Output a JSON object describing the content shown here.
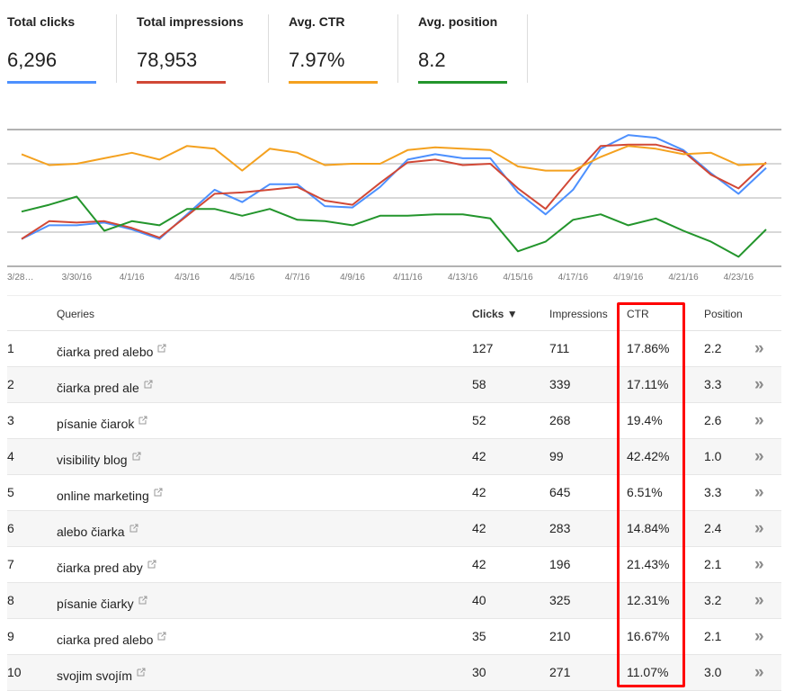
{
  "metrics": [
    {
      "label": "Total clicks",
      "value": "6,296",
      "color": "#4d90fe"
    },
    {
      "label": "Total impressions",
      "value": "78,953",
      "color": "#d14836"
    },
    {
      "label": "Avg. CTR",
      "value": "7.97%",
      "color": "#f4a11f"
    },
    {
      "label": "Avg. position",
      "value": "8.2",
      "color": "#23952c"
    }
  ],
  "chart_data": {
    "type": "line",
    "title": "",
    "xlabel": "",
    "ylabel": "",
    "grid": true,
    "legend": "none (metric tiles act as legend)",
    "x": [
      "3/28/16",
      "3/29/16",
      "3/30/16",
      "3/31/16",
      "4/1/16",
      "4/2/16",
      "4/3/16",
      "4/4/16",
      "4/5/16",
      "4/6/16",
      "4/7/16",
      "4/8/16",
      "4/9/16",
      "4/10/16",
      "4/11/16",
      "4/12/16",
      "4/13/16",
      "4/14/16",
      "4/15/16",
      "4/16/16",
      "4/17/16",
      "4/18/16",
      "4/19/16",
      "4/20/16",
      "4/21/16",
      "4/22/16",
      "4/23/16",
      "4/24/16"
    ],
    "tick_labels": [
      "3/28…",
      "3/30/16",
      "4/1/16",
      "4/3/16",
      "4/5/16",
      "4/7/16",
      "4/9/16",
      "4/11/16",
      "4/13/16",
      "4/15/16",
      "4/17/16",
      "4/19/16",
      "4/21/16",
      "4/23/16"
    ],
    "y_scale_note": "each series on its own hidden axis; values are relative (0-100)",
    "ylim": [
      0,
      100
    ],
    "series": [
      {
        "name": "Total clicks",
        "color": "#4d90fe",
        "values": [
          20,
          30,
          30,
          32,
          27,
          20,
          38,
          56,
          47,
          60,
          60,
          44,
          43,
          58,
          78,
          82,
          79,
          79,
          54,
          38,
          56,
          86,
          96,
          94,
          85,
          68,
          53,
          72
        ]
      },
      {
        "name": "Total impressions",
        "color": "#d14836",
        "values": [
          20,
          33,
          32,
          33,
          28,
          21,
          37,
          53,
          54,
          56,
          58,
          48,
          45,
          61,
          76,
          78,
          74,
          75,
          57,
          42,
          66,
          88,
          89,
          89,
          84,
          67,
          57,
          76
        ]
      },
      {
        "name": "Avg. CTR",
        "color": "#f4a11f",
        "values": [
          82,
          74,
          75,
          79,
          83,
          78,
          88,
          86,
          70,
          86,
          83,
          74,
          75,
          75,
          85,
          87,
          86,
          85,
          73,
          70,
          70,
          80,
          88,
          86,
          82,
          83,
          74,
          75
        ]
      },
      {
        "name": "Avg. position",
        "color": "#23952c",
        "values": [
          40,
          45,
          51,
          26,
          33,
          30,
          42,
          42,
          37,
          42,
          34,
          33,
          30,
          37,
          37,
          38,
          38,
          35,
          11,
          18,
          34,
          38,
          30,
          35,
          26,
          18,
          7,
          27
        ]
      }
    ]
  },
  "table": {
    "headers": {
      "rank": "",
      "queries": "Queries",
      "clicks": "Clicks ▼",
      "impressions": "Impressions",
      "ctr": "CTR",
      "position": "Position"
    },
    "more_icon": "»",
    "rows": [
      {
        "rank": "1",
        "query": "čiarka pred alebo",
        "clicks": "127",
        "impressions": "711",
        "ctr": "17.86%",
        "position": "2.2"
      },
      {
        "rank": "2",
        "query": "čiarka pred ale",
        "clicks": "58",
        "impressions": "339",
        "ctr": "17.11%",
        "position": "3.3"
      },
      {
        "rank": "3",
        "query": "písanie čiarok",
        "clicks": "52",
        "impressions": "268",
        "ctr": "19.4%",
        "position": "2.6"
      },
      {
        "rank": "4",
        "query": "visibility blog",
        "clicks": "42",
        "impressions": "99",
        "ctr": "42.42%",
        "position": "1.0"
      },
      {
        "rank": "5",
        "query": "online marketing",
        "clicks": "42",
        "impressions": "645",
        "ctr": "6.51%",
        "position": "3.3"
      },
      {
        "rank": "6",
        "query": "alebo čiarka",
        "clicks": "42",
        "impressions": "283",
        "ctr": "14.84%",
        "position": "2.4"
      },
      {
        "rank": "7",
        "query": "čiarka pred aby",
        "clicks": "42",
        "impressions": "196",
        "ctr": "21.43%",
        "position": "2.1"
      },
      {
        "rank": "8",
        "query": "písanie čiarky",
        "clicks": "40",
        "impressions": "325",
        "ctr": "12.31%",
        "position": "3.2"
      },
      {
        "rank": "9",
        "query": "ciarka pred alebo",
        "clicks": "35",
        "impressions": "210",
        "ctr": "16.67%",
        "position": "2.1"
      },
      {
        "rank": "10",
        "query": "svojim svojím",
        "clicks": "30",
        "impressions": "271",
        "ctr": "11.07%",
        "position": "3.0"
      }
    ]
  },
  "annotation": {
    "highlight_color": "#ff0000",
    "highlighted_column": "CTR"
  }
}
